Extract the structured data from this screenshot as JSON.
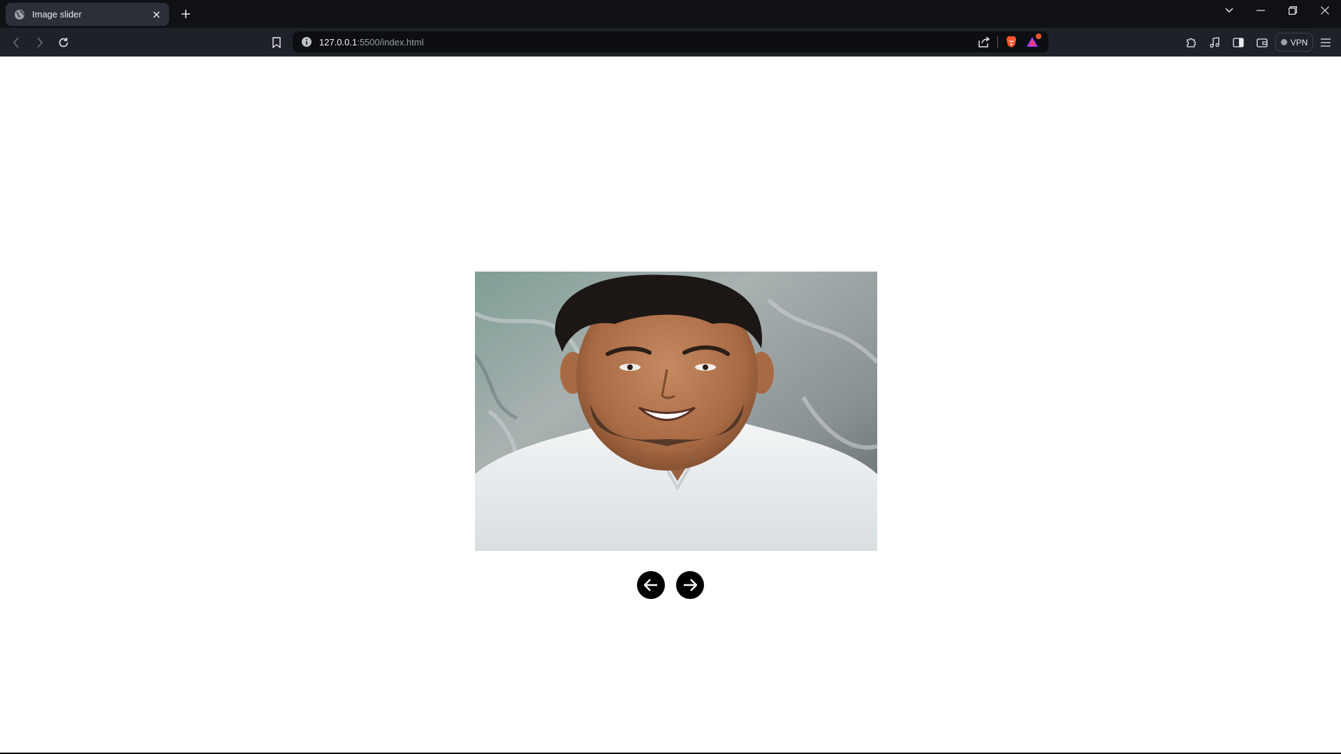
{
  "browser": {
    "tab": {
      "title": "Image slider",
      "favicon": "globe-icon"
    },
    "url": {
      "host": "127.0.0.1",
      "path": ":5500/index.html"
    },
    "vpn_label": "VPN",
    "accent": "#fb542b"
  },
  "page": {
    "slider": {
      "image_subject": "portrait-photo",
      "prev_icon": "arrow-left-icon",
      "next_icon": "arrow-right-icon"
    }
  }
}
